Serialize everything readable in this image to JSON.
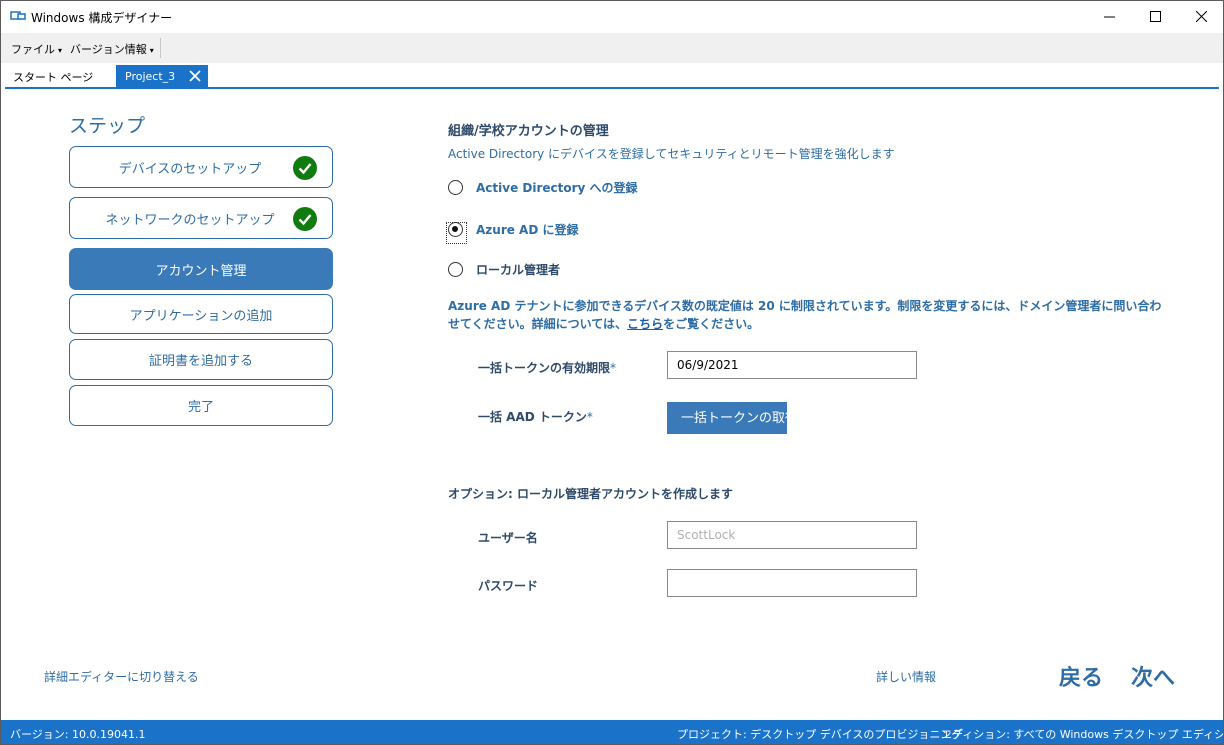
{
  "window": {
    "title": "Windows 構成デザイナー"
  },
  "menu": {
    "file": "ファイル",
    "version_info": "バージョン情報"
  },
  "tabs": {
    "start_page": "スタート ページ",
    "active": "Project_3"
  },
  "steps": {
    "heading": "ステップ",
    "items": [
      {
        "label": "デバイスのセットアップ",
        "completed": true
      },
      {
        "label": "ネットワークのセットアップ",
        "completed": true
      },
      {
        "label": "アカウント管理",
        "active": true
      },
      {
        "label": "アプリケーションの追加"
      },
      {
        "label": "証明書を追加する"
      },
      {
        "label": "完了"
      }
    ]
  },
  "account": {
    "title": "組織/学校アカウントの管理",
    "subtitle": "Active Directory にデバイスを登録してセキュリティとリモート管理を強化します",
    "options": [
      {
        "label": "Active Directory への登録",
        "selected": false
      },
      {
        "label": "Azure AD に登録",
        "selected": true
      },
      {
        "label": "ローカル管理者",
        "selected": false
      }
    ],
    "info_text": "Azure AD テナントに参加できるデバイス数の既定値は 20 に制限されています。制限を変更するには、ドメイン管理者に問い合わせてください。詳細については、",
    "info_link": "こちら",
    "info_tail": "をご覧ください。",
    "bulk_token_expiry_label": "一括トークンの有効期限",
    "bulk_token_expiry_value": "06/9/2021",
    "bulk_token_label": "一括 AAD トークン",
    "required_mark": "*",
    "get_token_button": "一括トークンの取得"
  },
  "local_admin": {
    "title": "オプション: ローカル管理者アカウントを作成します",
    "username_label": "ユーザー名",
    "username_placeholder": "ScottLock",
    "password_label": "パスワード",
    "password_value": ""
  },
  "footer": {
    "switch_advanced": "詳細エディターに切り替える",
    "more_info": "詳しい情報",
    "back": "戻る",
    "next": "次へ"
  },
  "status": {
    "version": "バージョン: 10.0.19041.1",
    "project": "プロジェクト: デスクトップ デバイスのプロビジョニング",
    "edition": "エディション: すべての Windows デスクトップ エディション"
  },
  "colors": {
    "accent": "#1a73c8",
    "step_active": "#3a7ab8",
    "text_blue": "#2e6da4",
    "check_green": "#107c10"
  }
}
